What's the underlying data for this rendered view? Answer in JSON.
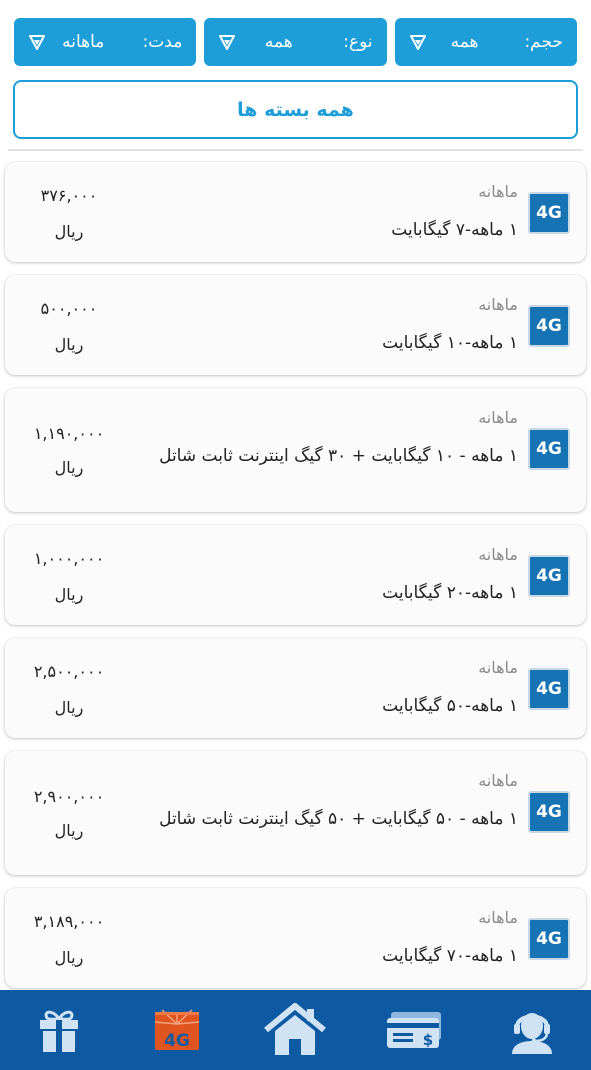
{
  "filters": [
    {
      "label": "مدت:",
      "value": "ماهانه"
    },
    {
      "label": "نوع:",
      "value": "همه"
    },
    {
      "label": "حجم:",
      "value": "همه"
    }
  ],
  "all_packages_label": "همه بسته ها",
  "packages": [
    {
      "badge": "4G",
      "period": "ماهانه",
      "title": "۱ ماهه-۷ گیگابایت",
      "price": "۳۷۶,۰۰۰",
      "currency": "ریال"
    },
    {
      "badge": "4G",
      "period": "ماهانه",
      "title": "۱ ماهه-۱۰ گیگابایت",
      "price": "۵۰۰,۰۰۰",
      "currency": "ریال"
    },
    {
      "badge": "4G",
      "period": "ماهانه",
      "title": "۱ ماهه - ۱۰ گیگابایت + ۳۰ گیگ اینترنت ثابت شاتل",
      "price": "۱,۱۹۰,۰۰۰",
      "currency": "ریال"
    },
    {
      "badge": "4G",
      "period": "ماهانه",
      "title": "۱ ماهه-۲۰ گیگابایت",
      "price": "۱,۰۰۰,۰۰۰",
      "currency": "ریال"
    },
    {
      "badge": "4G",
      "period": "ماهانه",
      "title": "۱ ماهه-۵۰ گیگابایت",
      "price": "۲,۵۰۰,۰۰۰",
      "currency": "ریال"
    },
    {
      "badge": "4G",
      "period": "ماهانه",
      "title": "۱ ماهه - ۵۰ گیگابایت + ۵۰ گیگ اینترنت ثابت شاتل",
      "price": "۲,۹۰۰,۰۰۰",
      "currency": "ریال"
    },
    {
      "badge": "4G",
      "period": "ماهانه",
      "title": "۱ ماهه-۷۰ گیگابایت",
      "price": "۳,۱۸۹,۰۰۰",
      "currency": "ریال"
    }
  ],
  "bottom_nav": [
    {
      "icon": "gift-icon"
    },
    {
      "icon": "4g-sim-icon",
      "badge_text": "4G"
    },
    {
      "icon": "home-icon"
    },
    {
      "icon": "billing-icon"
    },
    {
      "icon": "support-icon"
    }
  ],
  "colors": {
    "accent": "#1d9ed9",
    "nav_background": "#0d5aa3",
    "badge_blue": "#1673b4",
    "sim_orange": "#e0541f"
  }
}
